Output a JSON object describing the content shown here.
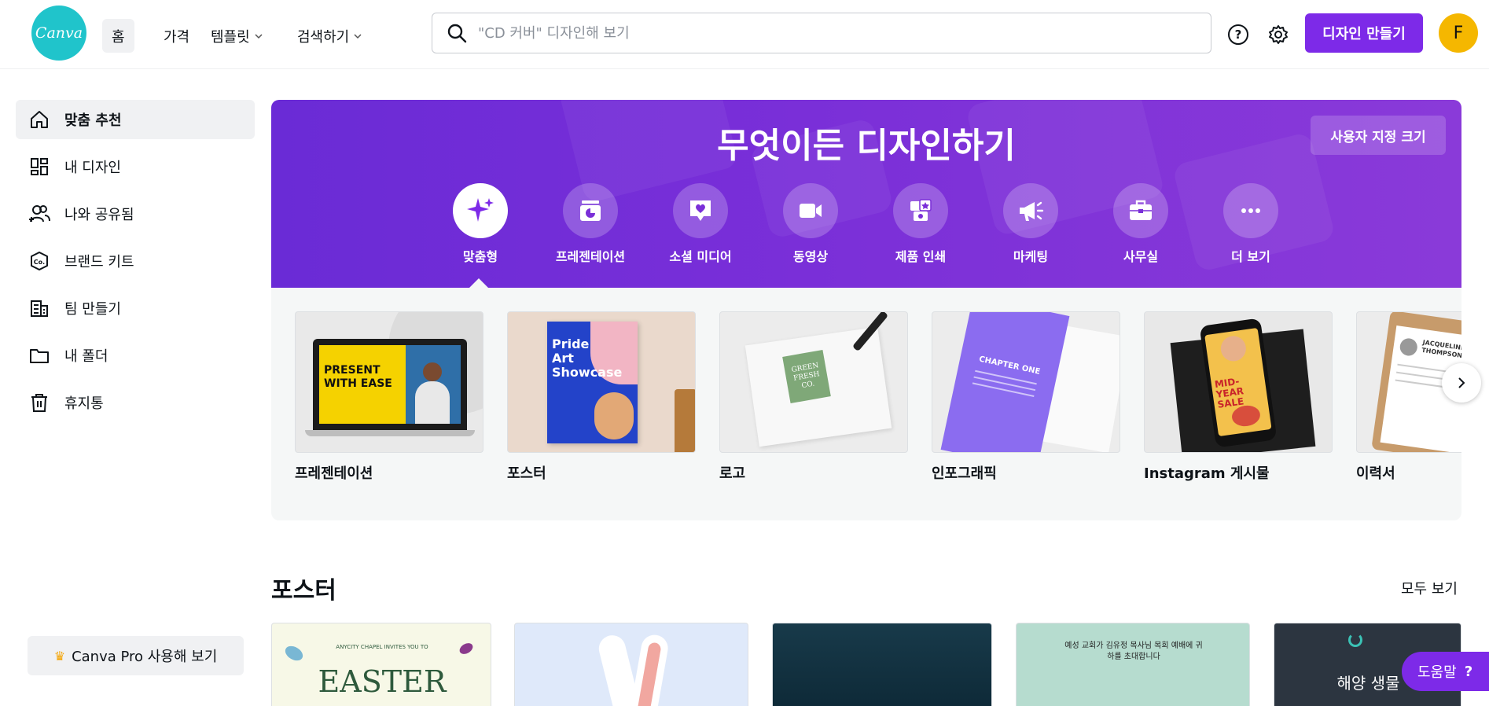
{
  "brand": {
    "logo_text": "Canva",
    "accent": "#7d2ae8"
  },
  "nav": {
    "home": "홈",
    "pricing": "가격",
    "templates": "템플릿",
    "discover": "검색하기"
  },
  "search": {
    "placeholder": "\"CD 커버\" 디자인해 보기"
  },
  "header": {
    "help_icon": "help-circle-icon",
    "settings_icon": "gear-icon",
    "create_label": "디자인 만들기",
    "avatar_initial": "F"
  },
  "sidebar": {
    "items": [
      {
        "label": "맞춤 추천",
        "icon": "home-icon"
      },
      {
        "label": "내 디자인",
        "icon": "grid-icon"
      },
      {
        "label": "나와 공유됨",
        "icon": "people-icon"
      },
      {
        "label": "브랜드 키트",
        "icon": "brand-kit-icon"
      },
      {
        "label": "팀 만들기",
        "icon": "building-icon"
      },
      {
        "label": "내 폴더",
        "icon": "folder-icon"
      },
      {
        "label": "휴지통",
        "icon": "trash-icon"
      }
    ],
    "pro_label": "Canva Pro 사용해 보기"
  },
  "hero": {
    "title": "무엇이든 디자인하기",
    "custom_size": "사용자 지정 크기",
    "categories": [
      {
        "label": "맞춤형",
        "icon": "sparkle-icon"
      },
      {
        "label": "프레젠테이션",
        "icon": "presentation-icon"
      },
      {
        "label": "소셜 미디어",
        "icon": "heart-chat-icon"
      },
      {
        "label": "동영상",
        "icon": "video-camera-icon"
      },
      {
        "label": "제품 인쇄",
        "icon": "print-product-icon"
      },
      {
        "label": "마케팅",
        "icon": "megaphone-icon"
      },
      {
        "label": "사무실",
        "icon": "briefcase-icon"
      },
      {
        "label": "더 보기",
        "icon": "more-dots-icon"
      }
    ]
  },
  "templates": [
    {
      "label": "프레젠테이션",
      "thumb_text": "PRESENT WITH EASE"
    },
    {
      "label": "포스터",
      "thumb_text": "Pride Art Showcase"
    },
    {
      "label": "로고",
      "thumb_text": "GREEN FRESH CO."
    },
    {
      "label": "인포그래픽",
      "thumb_text": "CHAPTER ONE"
    },
    {
      "label": "Instagram 게시물",
      "thumb_text": "MID-YEAR SALE"
    },
    {
      "label": "이력서",
      "thumb_text": "JACQUELINE THOMPSON"
    }
  ],
  "posters_section": {
    "title": "포스터",
    "see_all": "모두 보기",
    "items": [
      {
        "top_text": "ANYCITY CHAPEL INVITES YOU TO",
        "title": "EASTER"
      },
      {
        "top_text": "",
        "title": ""
      },
      {
        "top_text": "",
        "title": ""
      },
      {
        "top_text": "예성 교회가 김유정 목사님 목회 예배에 귀하를 초대합니다",
        "title": ""
      },
      {
        "top_text": "",
        "title": "해양 생물"
      }
    ]
  },
  "help": {
    "label": "도움말",
    "mark": "?"
  }
}
